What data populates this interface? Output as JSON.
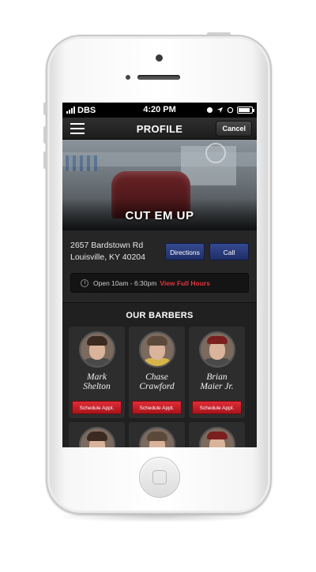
{
  "status_bar": {
    "carrier": "DBS",
    "time": "4:20 PM"
  },
  "nav": {
    "title": "PROFILE",
    "cancel_label": "Cancel"
  },
  "shop": {
    "name": "CUT EM UP",
    "address_line1": "2657 Bardstown Rd",
    "address_line2": "Louisville, KY 40204",
    "directions_label": "Directions",
    "call_label": "Call",
    "hours_text": "Open 10am - 6:30pm",
    "hours_link": "View Full Hours"
  },
  "barbers": {
    "section_title": "OUR BARBERS",
    "schedule_label": "Schedule Appt.",
    "items": [
      {
        "first": "Mark",
        "last": "Shelton"
      },
      {
        "first": "Chase",
        "last": "Crawford"
      },
      {
        "first": "Brian",
        "last": "Maier Jr."
      }
    ]
  },
  "icons": {
    "menu": "hamburger-icon",
    "clock": "clock-icon",
    "battery": "battery-icon",
    "signal": "signal-icon",
    "location": "location-arrow-icon"
  },
  "colors": {
    "accent_red": "#e0363e",
    "button_blue": "#354a91",
    "background": "#1c1c1c"
  }
}
